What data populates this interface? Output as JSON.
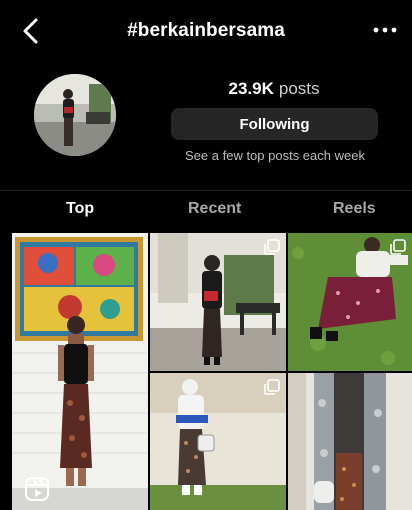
{
  "header": {
    "title": "#berkainbersama",
    "posts_count": "23.9K",
    "posts_label": "posts",
    "follow_button": "Following",
    "hint": "See a few top posts each week"
  },
  "tabs": [
    {
      "label": "Top",
      "active": true
    },
    {
      "label": "Recent",
      "active": false
    },
    {
      "label": "Reels",
      "active": false
    }
  ],
  "icons": {
    "back": "chevron-left-icon",
    "more": "more-horizontal-icon",
    "reels": "reels-icon",
    "multi": "carousel-icon"
  },
  "colors": {
    "background": "#000000",
    "button_bg": "#262626",
    "active_text": "#ffffff",
    "inactive_text": "#a8a8a8"
  }
}
